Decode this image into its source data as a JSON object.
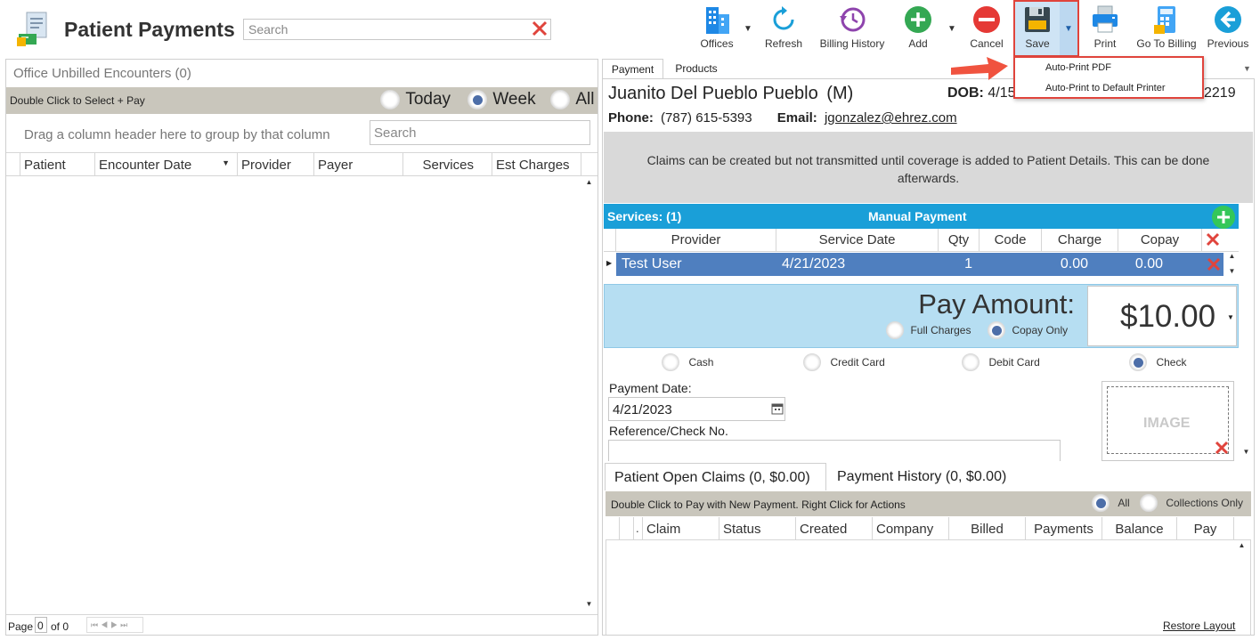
{
  "header": {
    "title": "Patient Payments",
    "search_placeholder": "Search",
    "toolbar": {
      "offices": "Offices",
      "refresh": "Refresh",
      "billing_history": "Billing History",
      "add": "Add",
      "cancel": "Cancel",
      "save": "Save",
      "print": "Print",
      "go_to_billing": "Go To Billing",
      "previous": "Previous"
    },
    "save_menu": [
      "Auto-Print PDF",
      "Auto-Print to Default Printer"
    ]
  },
  "left_panel": {
    "title": "Office Unbilled Encounters (0)",
    "instruction": "Double Click to Select + Pay",
    "range_options": [
      {
        "label": "Today",
        "selected": false
      },
      {
        "label": "Week",
        "selected": true
      },
      {
        "label": "All",
        "selected": false
      }
    ],
    "group_hint": "Drag a column header here to group by that column",
    "search_placeholder": "Search",
    "columns": [
      "Patient",
      "Encounter Date",
      "Provider",
      "Payer",
      "Services",
      "Est Charges"
    ],
    "pager": {
      "page_label": "Page",
      "page_value": "0",
      "of_label": "of 0"
    }
  },
  "right_panel": {
    "tabs": [
      "Payment",
      "Products"
    ],
    "active_tab": "Payment",
    "patient": {
      "name": "Juanito Del Pueblo Pueblo",
      "sex": "(M)",
      "dob_label": "DOB:",
      "dob_value": "4/15",
      "account_suffix": "2219",
      "phone_label": "Phone:",
      "phone_value": "(787) 615-5393",
      "email_label": "Email:",
      "email_value": "jgonzalez@ehrez.com"
    },
    "notice": "Claims can be created but not transmitted until coverage is added to Patient Details. This can be done afterwards.",
    "services": {
      "title": "Services: (1)",
      "mode": "Manual Payment",
      "columns": [
        "Provider",
        "Service Date",
        "Qty",
        "Code",
        "Charge",
        "Copay"
      ],
      "rows": [
        {
          "provider": "Test User",
          "service_date": "4/21/2023",
          "qty": "1",
          "code": "",
          "charge": "0.00",
          "copay": "0.00"
        }
      ]
    },
    "pay_amount": {
      "label": "Pay Amount:",
      "value": "$10.00",
      "options": [
        {
          "label": "Full Charges",
          "selected": false
        },
        {
          "label": "Copay Only",
          "selected": true
        }
      ]
    },
    "payment_methods": [
      {
        "label": "Cash",
        "selected": false
      },
      {
        "label": "Credit Card",
        "selected": false
      },
      {
        "label": "Debit Card",
        "selected": false
      },
      {
        "label": "Check",
        "selected": true
      }
    ],
    "payment_date_label": "Payment Date:",
    "payment_date_value": "4/21/2023",
    "reference_label": "Reference/Check No.",
    "image_label": "IMAGE",
    "claims_tabs": [
      "Patient Open Claims (0, $0.00)",
      "Payment History (0, $0.00)"
    ],
    "claims_instruction": "Double Click to Pay with New Payment. Right Click for Actions",
    "claims_filter": [
      {
        "label": "All",
        "selected": true
      },
      {
        "label": "Collections Only",
        "selected": false
      }
    ],
    "claims_columns": [
      ".",
      "Claim",
      "Status",
      "Created",
      "Company",
      "Billed",
      "Payments",
      "Balance",
      "Pay"
    ],
    "restore_layout": "Restore Layout"
  },
  "colors": {
    "accent_blue": "#1a9fd8",
    "selected_row": "#4f7fbf",
    "pay_amount_bg": "#b6def2",
    "highlight_red": "#e0443c",
    "grey_bar": "#c9c6bc"
  }
}
